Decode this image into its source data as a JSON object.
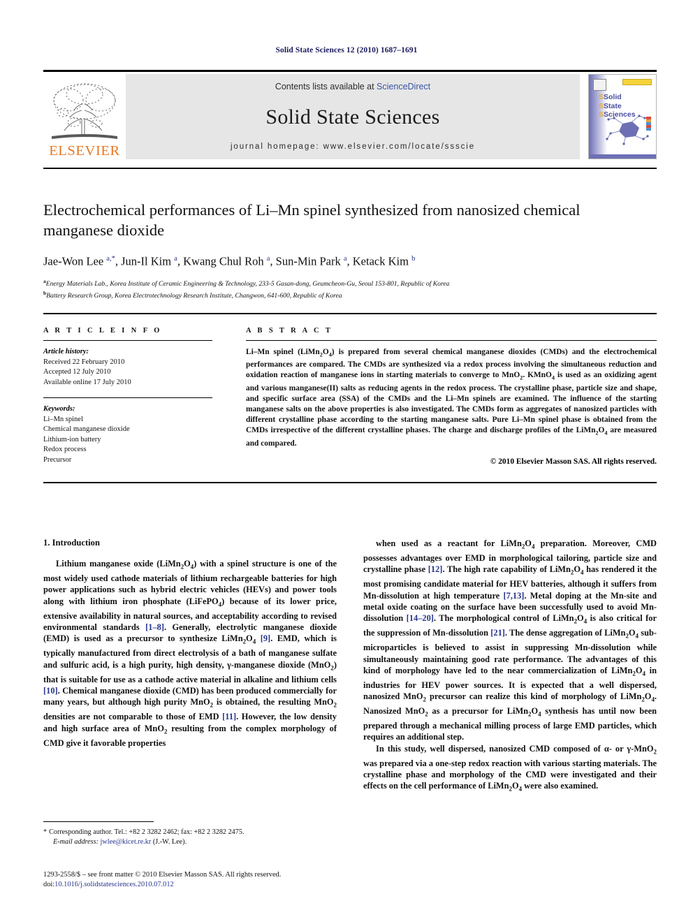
{
  "running_head": "Solid State Sciences 12 (2010) 1687–1691",
  "masthead": {
    "contents_prefix": "Contents lists available at ",
    "sciencedirect": "ScienceDirect",
    "journal_name": "Solid State Sciences",
    "homepage": "journal homepage: www.elsevier.com/locate/ssscie",
    "publisher": "ELSEVIER",
    "cover_title_lines": [
      "Solid",
      "State",
      "Sciences"
    ],
    "colors": {
      "sciencedirect_blue": "#3a53a4",
      "elsevier_orange": "#E87722",
      "masthead_grey": "#e6e6e6",
      "cover_purple": "#6d6fb5",
      "cover_yellow": "#f5d33a",
      "link_blue": "#26348b"
    }
  },
  "title": "Electrochemical performances of Li–Mn spinel synthesized from nanosized chemical manganese dioxide",
  "authors_html": "Jae-Won Lee <sup>a,*</sup>, Jun-Il Kim <sup>a</sup>, Kwang Chul Roh <sup>a</sup>, Sun-Min Park <sup>a</sup>, Ketack Kim <sup>b</sup>",
  "affiliations": [
    {
      "marker": "a",
      "text": "Energy Materials Lab., Korea Institute of Ceramic Engineering & Technology, 233-5 Gasan-dong, Geumcheon-Gu, Seoul 153-801, Republic of Korea"
    },
    {
      "marker": "b",
      "text": "Battery Research Group, Korea Electrotechnology Research Institute, Changwon, 641-600, Republic of Korea"
    }
  ],
  "article_info": {
    "heading": "A R T I C L E  I N F O",
    "history_label": "Article history:",
    "history": [
      "Received 22 February 2010",
      "Accepted 12 July 2010",
      "Available online 17 July 2010"
    ],
    "keywords_label": "Keywords:",
    "keywords": [
      "Li–Mn spinel",
      "Chemical manganese dioxide",
      "Lithium-ion battery",
      "Redox process",
      "Precursor"
    ]
  },
  "abstract": {
    "heading": "A B S T R A C T",
    "body_html": "Li–Mn spinel (LiMn<sub>2</sub>O<sub>4</sub>) is prepared from several chemical manganese dioxides (CMDs) and the electrochemical performances are compared. The CMDs are synthesized via a redox process involving the simultaneous reduction and oxidation reaction of manganese ions in starting materials to converge to MnO<sub>2</sub>. KMnO<sub>4</sub> is used as an oxidizing agent and various manganese(II) salts as reducing agents in the redox process. The crystalline phase, particle size and shape, and specific surface area (SSA) of the CMDs and the Li–Mn spinels are examined. The influence of the starting manganese salts on the above properties is also investigated. The CMDs form as aggregates of nanosized particles with different crystalline phase according to the starting manganese salts. Pure Li–Mn spinel phase is obtained from the CMDs irrespective of the different crystalline phases. The charge and discharge profiles of the LiMn<sub>2</sub>O<sub>4</sub> are measured and compared.",
    "copyright": "© 2010 Elsevier Masson SAS. All rights reserved."
  },
  "body": {
    "section_number_title": "1.  Introduction",
    "left_paragraph_html": "Lithium manganese oxide (LiMn<sub>2</sub>O<sub>4</sub>) with a spinel structure is one of the most widely used cathode materials of lithium rechargeable batteries for high power applications such as hybrid electric vehicles (HEVs) and power tools along with lithium iron phosphate (LiFePO<sub>4</sub>) because of its lower price, extensive availability in natural sources, and acceptability according to revised environmental standards <span class=\"ref\">[1–8]</span>. Generally, electrolytic manganese dioxide (EMD) is used as a precursor to synthesize LiMn<sub>2</sub>O<sub>4</sub> <span class=\"ref\">[9]</span>. EMD, which is typically manufactured from direct electrolysis of a bath of manganese sulfate and sulfuric acid, is a high purity, high density, γ-manganese dioxide (MnO<sub>2</sub>) that is suitable for use as a cathode active material in alkaline and lithium cells <span class=\"ref\">[10]</span>. Chemical manganese dioxide (CMD) has been produced commercially for many years, but although high purity MnO<sub>2</sub> is obtained, the resulting MnO<sub>2</sub> densities are not comparable to those of EMD <span class=\"ref\">[11]</span>. However, the low density and high surface area of MnO<sub>2</sub> resulting from the complex morphology of CMD give it favorable properties",
    "right_paragraph_1_html": "when used as a reactant for LiMn<sub>2</sub>O<sub>4</sub> preparation. Moreover, CMD possesses advantages over EMD in morphological tailoring, particle size and crystalline phase <span class=\"ref\">[12]</span>. The high rate capability of LiMn<sub>2</sub>O<sub>4</sub> has rendered it the most promising candidate material for HEV batteries, although it suffers from Mn-dissolution at high temperature <span class=\"ref\">[7,13]</span>. Metal doping at the Mn-site and metal oxide coating on the surface have been successfully used to avoid Mn-dissolution <span class=\"ref\">[14–20]</span>. The morphological control of LiMn<sub>2</sub>O<sub>4</sub> is also critical for the suppression of Mn-dissolution <span class=\"ref\">[21]</span>. The dense aggregation of LiMn<sub>2</sub>O<sub>4</sub> sub-microparticles is believed to assist in suppressing Mn-dissolution while simultaneously maintaining good rate performance. The advantages of this kind of morphology have led to the near commercialization of LiMn<sub>2</sub>O<sub>4</sub> in industries for HEV power sources. It is expected that a well dispersed, nanosized MnO<sub>2</sub> precursor can realize this kind of morphology of LiMn<sub>2</sub>O<sub>4</sub>. Nanosized MnO<sub>2</sub> as a precursor for LiMn<sub>2</sub>O<sub>4</sub> synthesis has until now been prepared through a mechanical milling process of large EMD particles, which requires an additional step.",
    "right_paragraph_2_html": "In this study, well dispersed, nanosized CMD composed of α- or γ-MnO<sub>2</sub> was prepared via a one-step redox reaction with various starting materials. The crystalline phase and morphology of the CMD were investigated and their effects on the cell performance of LiMn<sub>2</sub>O<sub>4</sub> were also examined."
  },
  "footnote": {
    "star": "*",
    "corresponding_html": "Corresponding author. Tel.: +82 2 3282 2462; fax: +82 2 3282 2475.",
    "email_label": "E-mail address:",
    "email": "jwlee@kicet.re.kr",
    "email_suffix": "(J.-W. Lee)."
  },
  "imprint": {
    "line1": "1293-2558/$ – see front matter © 2010 Elsevier Masson SAS. All rights reserved.",
    "doi_label": "doi:",
    "doi_value": "10.1016/j.solidstatesciences.2010.07.012"
  }
}
